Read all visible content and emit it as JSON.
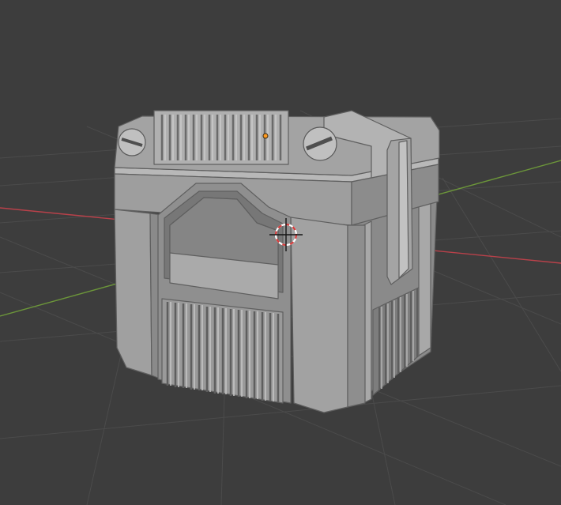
{
  "viewport": {
    "background": "#3d3d3d",
    "grid_color": "#4a4a4a",
    "x_axis_color": "#c4454b",
    "y_axis_color": "#6f9a3c"
  },
  "object": {
    "type": "hard-surface crate",
    "material_color": "#9a9a9a",
    "shadow_color": "#5c5c5c",
    "highlight_color": "#c8c8c8",
    "origin_color": "#ff9a1f"
  },
  "cursor": {
    "type": "3d-cursor",
    "ring_colors": [
      "#d93b3b",
      "#ffffff"
    ]
  }
}
